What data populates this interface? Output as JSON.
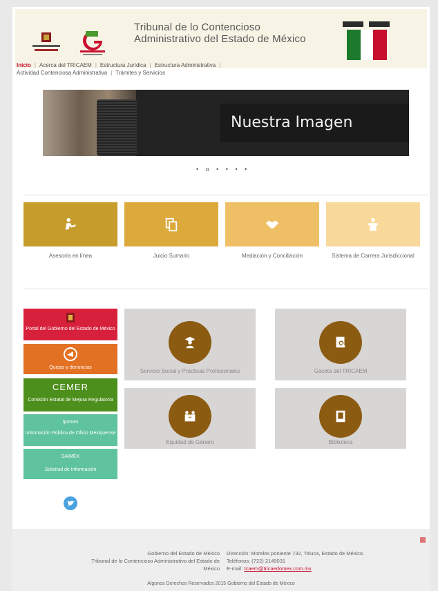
{
  "header": {
    "title_line1": "Tribunal de lo Contencioso",
    "title_line2": "Administrativo del Estado de México"
  },
  "nav": {
    "items": [
      {
        "label": "Inicio",
        "active": true
      },
      {
        "label": "Acerca del TRICAEM"
      },
      {
        "label": "Estructura Jurídica"
      },
      {
        "label": "Estructura Administrativa"
      },
      {
        "label": "Actividad Contenciosa Administrativa"
      },
      {
        "label": "Trámites y Servicios"
      }
    ]
  },
  "banner": {
    "caption": "Nuestra Imagen",
    "dots": "• o • • • •"
  },
  "services": [
    {
      "label": "Asesoría en línea",
      "color": "#c69c2d",
      "icon": "person-laptop-icon"
    },
    {
      "label": "Juicio Sumario",
      "color": "#dca93d",
      "icon": "documents-icon"
    },
    {
      "label": "Mediación y Conciliación",
      "color": "#efbf66",
      "icon": "handshake-icon"
    },
    {
      "label": "Sistema de Carrera Jurisdiccional",
      "color": "#f9d99b",
      "icon": "podium-icon"
    }
  ],
  "sidebar": [
    {
      "label": "Portal del Gobierno del Estado de México",
      "color": "#d7203b"
    },
    {
      "label": "Quejas y denuncias",
      "color": "#e37123"
    },
    {
      "label_top": "CEMER",
      "label": "Comisión Estatal de Mejora Regulatoria",
      "color": "#4d8f1c"
    },
    {
      "label_top": "Ipomex",
      "label": "Información Pública de Oficio Mexiquense",
      "color": "#5fc39e"
    },
    {
      "label_top": "SAIMEX",
      "label": "Solicitud de Información",
      "color": "#5fc39e"
    }
  ],
  "cards": [
    {
      "label": "Servicio Social y Prácticas Profesionales",
      "icon": "student-icon"
    },
    {
      "label": "Gaceta del TRICAEM",
      "icon": "gazette-icon"
    },
    {
      "label": "Equidad de Género",
      "icon": "family-icon"
    },
    {
      "label": "Biblioteca",
      "icon": "book-icon"
    }
  ],
  "footer": {
    "left_line1": "Gobierno del Estado de México",
    "left_line2": "Tribunal de lo Contencioso Administrativo del Estado de",
    "left_line3": "México",
    "address": "Dirección: Morelos poniente 732, Toluca, Estado de México.",
    "phone": "Teléfonos: (722) 2149031",
    "email_label": "E-mail:",
    "email": "tcaem@tricaedomex.com.mx",
    "copyright": "Algunos Derechos Reservados 2015 Gobierno del Estado de México"
  },
  "colors": {
    "accent_red": "#c8102e",
    "card_circle": "#8b5b12",
    "card_bg": "#d8d5d5"
  }
}
